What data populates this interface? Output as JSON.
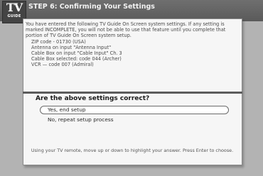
{
  "header": {
    "logo_top": "TV",
    "logo_bottom": "GUIDE",
    "title": "STEP 6: Confirming Your Settings"
  },
  "info": {
    "intro": "You have entered the following TV Guide On Screen system settings. If any setting is marked INCOMPLETE, you will not be able to use that feature until you complete that portion of TV Guide On Screen system setup.",
    "settings": [
      "ZIP code - 01730 (USA)",
      "Antenna on input \"Antenna Input\"",
      "Cable Box on input \"Cable Input\" Ch. 3",
      "Cable Box selected: code 044 (Archer)",
      "VCR — code 007 (Admiral)"
    ]
  },
  "prompt": {
    "question": "Are the above settings correct?",
    "options": [
      {
        "label": "Yes, end setup",
        "selected": true
      },
      {
        "label": "No, repeat setup process",
        "selected": false
      }
    ]
  },
  "footer": {
    "instruction": "Using your TV remote, move up or down to highlight your answer. Press Enter to choose."
  }
}
